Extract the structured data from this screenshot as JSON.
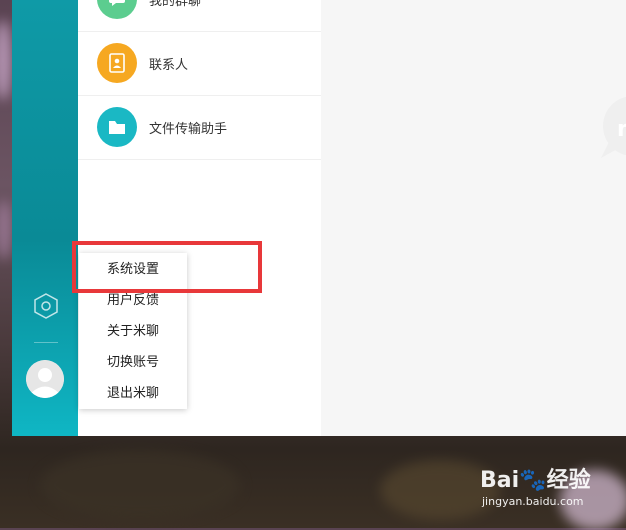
{
  "contacts_list": {
    "items": [
      {
        "label": "我的群聊",
        "icon": "group-chat-icon",
        "color": "#5ccd8f"
      },
      {
        "label": "联系人",
        "icon": "contacts-book-icon",
        "color": "#f6a821"
      },
      {
        "label": "文件传输助手",
        "icon": "folder-icon",
        "color": "#1ab8c4"
      }
    ]
  },
  "context_menu": {
    "items": [
      "系统设置",
      "用户反馈",
      "关于米聊",
      "切换账号",
      "退出米聊"
    ]
  },
  "colors": {
    "sidebar": "#0f9aa7",
    "highlight": "#e8383a",
    "background": "#f6f6f6"
  },
  "watermark": {
    "brand": "Bai",
    "brand2": "经验",
    "url": "jingyan.baidu.com"
  }
}
